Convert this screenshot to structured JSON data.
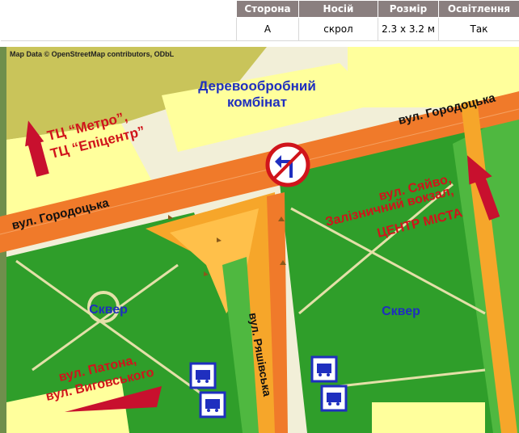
{
  "table": {
    "headers": [
      "Сторона",
      "Носій",
      "Розмір",
      "Освітлення"
    ],
    "row": [
      "A",
      "скрол",
      "2.3 x 3.2 м",
      "Так"
    ]
  },
  "map": {
    "attribution": "Map Data © OpenStreetMap contributors, ODbL",
    "labels": {
      "plant_line1": "Деревообробний",
      "plant_line2": "комбінат",
      "tc_line1": "ТЦ “Метро”,",
      "tc_line2": "ТЦ “Епіцентр”",
      "street_gorodotska_top": "вул. Городоцька",
      "street_gorodotska_left": "вул. Городоцька",
      "sqver_left": "Сквер",
      "sqver_right": "Сквер",
      "street_ryashivska": "вул. Ряшівська",
      "dir_right_line1": "вул. Сяйво,",
      "dir_right_line2": "Залізничний вокзал,",
      "dir_right_line3": "ЦЕНТР МІСТА",
      "dir_left_line1": "вул. Патона,",
      "dir_left_line2": "вул. Виговського"
    },
    "icons": [
      "no-left-turn-sign-icon",
      "bus-stop-icon",
      "bus-stop-icon",
      "bus-stop-icon",
      "bus-stop-icon"
    ],
    "colors": {
      "road_main": "#f07a2a",
      "road_secondary": "#f6a62a",
      "park": "#2f9e2a",
      "park_light": "#4fb840",
      "building": "#ffff9c",
      "arrow_red": "#c8102e",
      "label_blue": "#1f2fbf",
      "label_red": "#d0141b"
    }
  }
}
